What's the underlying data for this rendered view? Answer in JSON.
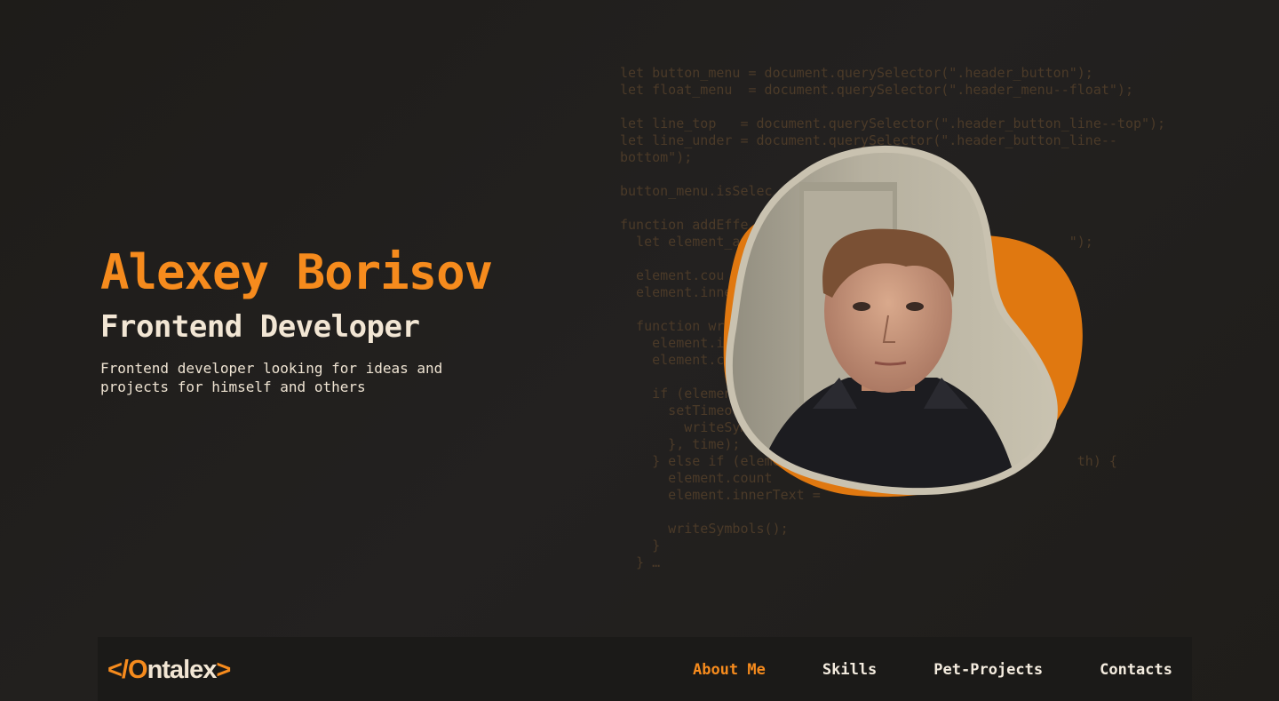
{
  "hero": {
    "name": "Alexey Borisov",
    "role": "Frontend Developer",
    "description": "Frontend developer looking for ideas and projects for himself and others"
  },
  "code_background": [
    "let button_menu = document.querySelector(\".header_button\");",
    "let float_menu  = document.querySelector(\".header_menu--float\");",
    "",
    "let line_top   = document.querySelector(\".header_button_line--top\");",
    "let line_under = document.querySelector(\".header_button_line--",
    "bottom\");",
    "",
    "button_menu.isSelec",
    "",
    "function addEffe",
    "  let element_a                                         \");",
    "",
    "  element.cou",
    "  element.inne",
    "",
    "  function wr",
    "    element.i",
    "    element.c",
    "",
    "    if (element",
    "      setTimeou",
    "        writeSym",
    "      }, time);",
    "    } else if (elemen                                    th) {",
    "      element.count",
    "      element.innerText =",
    "",
    "      writeSymbols();",
    "    }",
    "  } …"
  ],
  "avatar": {
    "alt": "portrait photo",
    "accent": "#e07810",
    "frame": "#c9c2b0"
  },
  "logo": {
    "open": "</",
    "O": "O",
    "rest": "ntalex",
    "close": ">"
  },
  "nav": [
    {
      "label": "About Me",
      "active": true
    },
    {
      "label": "Skills",
      "active": false
    },
    {
      "label": "Pet-Projects",
      "active": false
    },
    {
      "label": "Contacts",
      "active": false
    }
  ],
  "colors": {
    "accent": "#f68b1d",
    "background": "#1f1d1a",
    "text": "#f2e6d4"
  }
}
